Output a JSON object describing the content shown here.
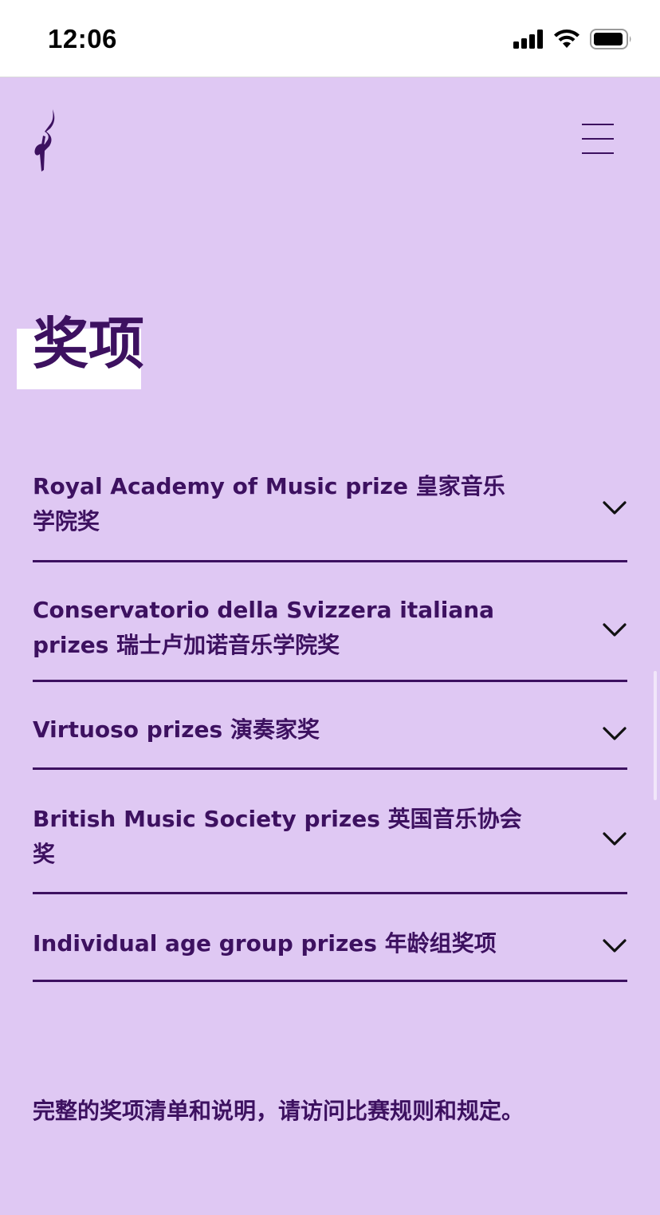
{
  "status_bar": {
    "time": "12:06",
    "icons": [
      "signal-icon",
      "wifi-icon",
      "battery-icon"
    ]
  },
  "header": {
    "logo_icon": "music-note-logo-icon",
    "menu_icon": "hamburger-menu-icon"
  },
  "main": {
    "title": "奖项",
    "prizes": [
      {
        "label": "Royal Academy of Music prize 皇家音乐学院奖"
      },
      {
        "label": "Conservatorio della Svizzera italiana prizes 瑞士卢加诺音乐学院奖"
      },
      {
        "label": "Virtuoso prizes 演奏家奖"
      },
      {
        "label": "British Music Society prizes 英国音乐协会奖"
      },
      {
        "label": "Individual age group prizes 年龄组奖项"
      }
    ],
    "footer_note": "完整的奖项清单和说明，请访问比赛规则和规定。"
  },
  "colors": {
    "background": "#dfc8f3",
    "text": "#3d1160"
  }
}
